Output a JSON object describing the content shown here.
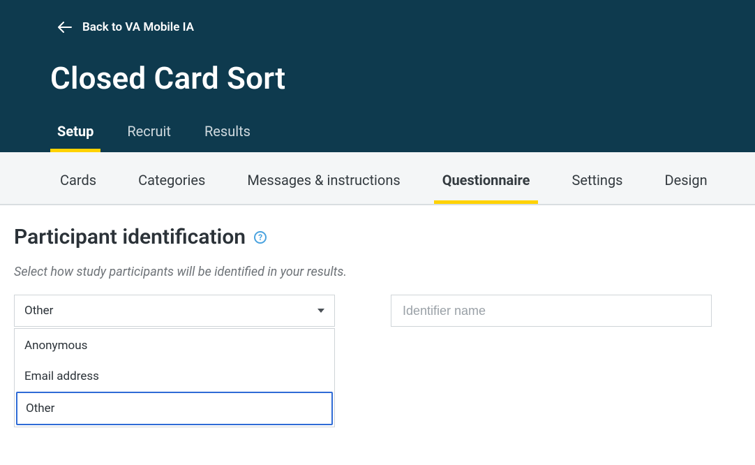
{
  "header": {
    "back_label": "Back to VA Mobile IA",
    "title": "Closed Card Sort"
  },
  "primary_tabs": {
    "setup": "Setup",
    "recruit": "Recruit",
    "results": "Results"
  },
  "sub_tabs": {
    "cards": "Cards",
    "categories": "Categories",
    "messages": "Messages & instructions",
    "questionnaire": "Questionnaire",
    "settings": "Settings",
    "design": "Design"
  },
  "section": {
    "title": "Participant identification",
    "help_glyph": "?",
    "description": "Select how study participants will be identified in your results."
  },
  "identifier": {
    "selected": "Other",
    "options": {
      "anonymous": "Anonymous",
      "email": "Email address",
      "other": "Other"
    },
    "name_placeholder": "Identifier name"
  }
}
